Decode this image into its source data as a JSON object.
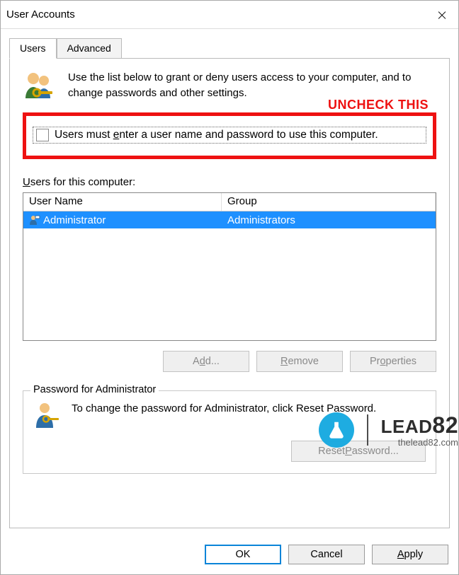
{
  "window": {
    "title": "User Accounts"
  },
  "tabs": {
    "users": "Users",
    "advanced": "Advanced",
    "active": "users"
  },
  "intro": {
    "text": "Use the list below to grant or deny users access to your computer, and to change passwords and other settings."
  },
  "annotation": {
    "label": "UNCHECK THIS"
  },
  "checkbox": {
    "label_pre": "Users must ",
    "label_acc": "e",
    "label_post": "nter a user name and password to use this computer.",
    "checked": false
  },
  "users_section": {
    "label_pre": "",
    "label_acc": "U",
    "label_post": "sers for this computer:"
  },
  "list": {
    "columns": {
      "user": "User Name",
      "group": "Group"
    },
    "rows": [
      {
        "user": "Administrator",
        "group": "Administrators",
        "selected": true
      }
    ]
  },
  "buttons": {
    "add_pre": "A",
    "add_acc": "d",
    "add_post": "d...",
    "remove_pre": "",
    "remove_acc": "R",
    "remove_post": "emove",
    "properties_pre": "Pr",
    "properties_acc": "o",
    "properties_post": "perties"
  },
  "password_box": {
    "legend": "Password for Administrator",
    "text": "To change the password for Administrator, click Reset Password.",
    "reset_pre": "Reset ",
    "reset_acc": "P",
    "reset_post": "assword..."
  },
  "footer": {
    "ok": "OK",
    "cancel": "Cancel",
    "apply_pre": "",
    "apply_acc": "A",
    "apply_post": "pply"
  },
  "watermark": {
    "brand_a": "LEAD",
    "brand_b": "82",
    "url": "thelead82.com"
  }
}
